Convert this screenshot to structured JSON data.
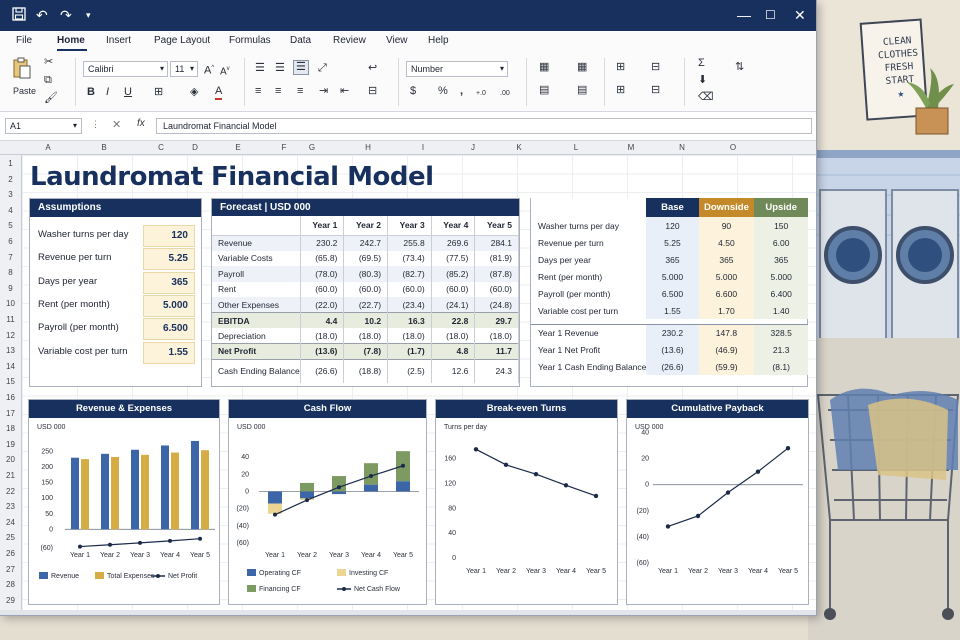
{
  "app": {
    "quick_access": [
      "save-icon",
      "undo-icon",
      "redo-icon",
      "customize-icon"
    ],
    "window_controls": [
      "—",
      "☐",
      "✕"
    ]
  },
  "menu": {
    "items": [
      "File",
      "Home",
      "Insert",
      "Page Layout",
      "Formulas",
      "Data",
      "Review",
      "View",
      "Help"
    ],
    "active": "Home"
  },
  "ribbon": {
    "paste_label": "Paste",
    "font_name": "Calibri",
    "font_size": "11",
    "number_format": "Number"
  },
  "formula_bar": {
    "name_box": "A1",
    "fx": "fx",
    "content": "Laundromat Financial Model"
  },
  "columns": [
    "A",
    "B",
    "C",
    "D",
    "E",
    "F",
    "G",
    "H",
    "I",
    "J",
    "K",
    "L",
    "M",
    "N",
    "O"
  ],
  "rows": [
    "1",
    "2",
    "3",
    "4",
    "5",
    "6",
    "7",
    "8",
    "9",
    "10",
    "11",
    "12",
    "13",
    "14",
    "15",
    "16",
    "17",
    "18",
    "19",
    "20",
    "21",
    "22",
    "23",
    "24",
    "25",
    "26",
    "27",
    "28",
    "29"
  ],
  "sheet_title": "Laundromat Financial Model",
  "assumptions": {
    "title": "Assumptions",
    "items": [
      {
        "label": "Washer turns per day",
        "value": "120"
      },
      {
        "label": "Revenue per turn",
        "value": "5.25"
      },
      {
        "label": "Days per year",
        "value": "365"
      },
      {
        "label": "Rent (per month)",
        "value": "5.000"
      },
      {
        "label": "Payroll (per month)",
        "value": "6.500"
      },
      {
        "label": "Variable cost per turn",
        "value": "1.55"
      }
    ]
  },
  "forecast": {
    "title": "Forecast | USD 000",
    "years": [
      "Year 1",
      "Year 2",
      "Year 3",
      "Year 4",
      "Year 5"
    ],
    "rows": [
      {
        "label": "Revenue",
        "values": [
          "230.2",
          "242.7",
          "255.8",
          "269.6",
          "284.1"
        ],
        "style": "odd"
      },
      {
        "label": "Variable Costs",
        "values": [
          "(65.8)",
          "(69.5)",
          "(73.4)",
          "(77.5)",
          "(81.9)"
        ],
        "style": ""
      },
      {
        "label": "Payroll",
        "values": [
          "(78.0)",
          "(80.3)",
          "(82.7)",
          "(85.2)",
          "(87.8)"
        ],
        "style": "odd"
      },
      {
        "label": "Rent",
        "values": [
          "(60.0)",
          "(60.0)",
          "(60.0)",
          "(60.0)",
          "(60.0)"
        ],
        "style": ""
      },
      {
        "label": "Other Expenses",
        "values": [
          "(22.0)",
          "(22.7)",
          "(23.4)",
          "(24.1)",
          "(24.8)"
        ],
        "style": "odd"
      },
      {
        "label": "EBITDA",
        "values": [
          "4.4",
          "10.2",
          "16.3",
          "22.8",
          "29.7"
        ],
        "style": "hl"
      },
      {
        "label": "Depreciation",
        "values": [
          "(18.0)",
          "(18.0)",
          "(18.0)",
          "(18.0)",
          "(18.0)"
        ],
        "style": ""
      },
      {
        "label": "Net Profit",
        "values": [
          "(13.6)",
          "(7.8)",
          "(1.7)",
          "4.8",
          "11.7"
        ],
        "style": "hl"
      },
      {
        "label": "Cash Ending Balance",
        "values": [
          "(26.6)",
          "(18.8)",
          "(2.5)",
          "12.6",
          "24.3"
        ],
        "style": "sum"
      }
    ]
  },
  "scenarios": {
    "headers": [
      "Base",
      "Downside",
      "Upside"
    ],
    "header_colors": [
      "#17305d",
      "#c48a2a",
      "#6f8a58"
    ],
    "inputs": [
      {
        "label": "Washer turns per day",
        "values": [
          "120",
          "90",
          "150"
        ]
      },
      {
        "label": "Revenue per turn",
        "values": [
          "5.25",
          "4.50",
          "6.00"
        ]
      },
      {
        "label": "Days per year",
        "values": [
          "365",
          "365",
          "365"
        ]
      },
      {
        "label": "Rent (per month)",
        "values": [
          "5.000",
          "5.000",
          "5.000"
        ]
      },
      {
        "label": "Payroll (per month)",
        "values": [
          "6.500",
          "6.600",
          "6.400"
        ]
      },
      {
        "label": "Variable cost per turn",
        "values": [
          "1.55",
          "1.70",
          "1.40"
        ]
      }
    ],
    "outputs": [
      {
        "label": "Year 1 Revenue",
        "values": [
          "230.2",
          "147.8",
          "328.5"
        ]
      },
      {
        "label": "Year 1 Net Profit",
        "values": [
          "(13.6)",
          "(46.9)",
          "21.3"
        ]
      },
      {
        "label": "Year 1 Cash Ending Balance",
        "values": [
          "(26.6)",
          "(59.9)",
          "(8.1)"
        ]
      }
    ]
  },
  "colors": {
    "navy": "#17305d",
    "blue": "#3d66a8",
    "gold": "#d6ad45",
    "green": "#7d9a63",
    "line": "#1b2a4a"
  },
  "chart_data": [
    {
      "type": "bar",
      "title": "Revenue & Expenses",
      "unit_label": "USD 000",
      "categories": [
        "Year 1",
        "Year 2",
        "Year 3",
        "Year 4",
        "Year 5"
      ],
      "series": [
        {
          "name": "Revenue",
          "kind": "bar",
          "color": "#3d66a8",
          "values": [
            230.2,
            242.7,
            255.8,
            269.6,
            284.1
          ]
        },
        {
          "name": "Total Expenses",
          "kind": "bar",
          "color": "#d6ad45",
          "values": [
            225.8,
            232.5,
            239.5,
            246.8,
            254.4
          ]
        },
        {
          "name": "Net Profit",
          "kind": "line",
          "color": "#1b2a4a",
          "values": [
            -13.6,
            -7.8,
            -1.7,
            4.8,
            11.7
          ]
        }
      ],
      "ylim": [
        -60,
        300
      ],
      "yticks": [
        {
          "v": 0,
          "t": "0"
        },
        {
          "v": -60,
          "t": "(60)"
        }
      ],
      "yticks_pos": [
        0,
        50,
        100,
        150,
        200,
        250
      ]
    },
    {
      "type": "bar",
      "title": "Cash Flow",
      "unit_label": "USD 000",
      "categories": [
        "Year 1",
        "Year 2",
        "Year 3",
        "Year 4",
        "Year 5"
      ],
      "series": [
        {
          "name": "Operating CF",
          "kind": "stack",
          "color": "#3d66a8",
          "values": [
            -14,
            -8,
            -3,
            8,
            12
          ]
        },
        {
          "name": "Investing CF",
          "kind": "stack",
          "color": "#ecd493",
          "values": [
            -12,
            -2,
            0,
            0,
            0
          ]
        },
        {
          "name": "Financing CF",
          "kind": "stack",
          "color": "#7d9a63",
          "values": [
            0,
            10,
            18,
            25,
            35
          ]
        },
        {
          "name": "Net Cash Flow",
          "kind": "line",
          "color": "#1b2a4a",
          "values": [
            -27,
            -10,
            5,
            18,
            30
          ]
        }
      ],
      "ylim": [
        -60,
        60
      ],
      "yticks": [
        {
          "v": 40,
          "t": "40"
        },
        {
          "v": 20,
          "t": "20"
        },
        {
          "v": 0,
          "t": "0"
        },
        {
          "v": -20,
          "t": "(20)"
        },
        {
          "v": -40,
          "t": "(40)"
        },
        {
          "v": -60,
          "t": "(60)"
        }
      ]
    },
    {
      "type": "line",
      "title": "Break-even Turns",
      "unit_label": "Turns per day",
      "categories": [
        "Year 1",
        "Year 2",
        "Year 3",
        "Year 4",
        "Year 5"
      ],
      "series": [
        {
          "name": "Break-even Turns",
          "color": "#1b2a4a",
          "values": [
            175,
            150,
            135,
            117,
            100
          ]
        }
      ],
      "ylim": [
        0,
        190
      ],
      "yticks": [
        {
          "v": 0,
          "t": "0"
        },
        {
          "v": 40,
          "t": "40"
        },
        {
          "v": 80,
          "t": "80"
        },
        {
          "v": 120,
          "t": "120"
        },
        {
          "v": 160,
          "t": "160"
        }
      ]
    },
    {
      "type": "line",
      "title": "Cumulative Payback",
      "unit_label": "USD 000",
      "categories": [
        "Year 1",
        "Year 2",
        "Year 3",
        "Year 4",
        "Year 5"
      ],
      "series": [
        {
          "name": "Cumulative Payback",
          "color": "#1b2a4a",
          "values": [
            -32,
            -24,
            -6,
            10,
            28
          ]
        }
      ],
      "ylim": [
        -70,
        45
      ],
      "yticks": [
        {
          "v": 40,
          "t": "40"
        },
        {
          "v": 20,
          "t": "20"
        },
        {
          "v": 0,
          "t": "0"
        },
        {
          "v": -20,
          "t": "(20)"
        },
        {
          "v": -40,
          "t": "(40)"
        },
        {
          "v": -60,
          "t": "(60)"
        }
      ]
    }
  ],
  "poster": {
    "text": [
      "CLEAN",
      "CLOTHES",
      "FRESH",
      "START"
    ]
  }
}
